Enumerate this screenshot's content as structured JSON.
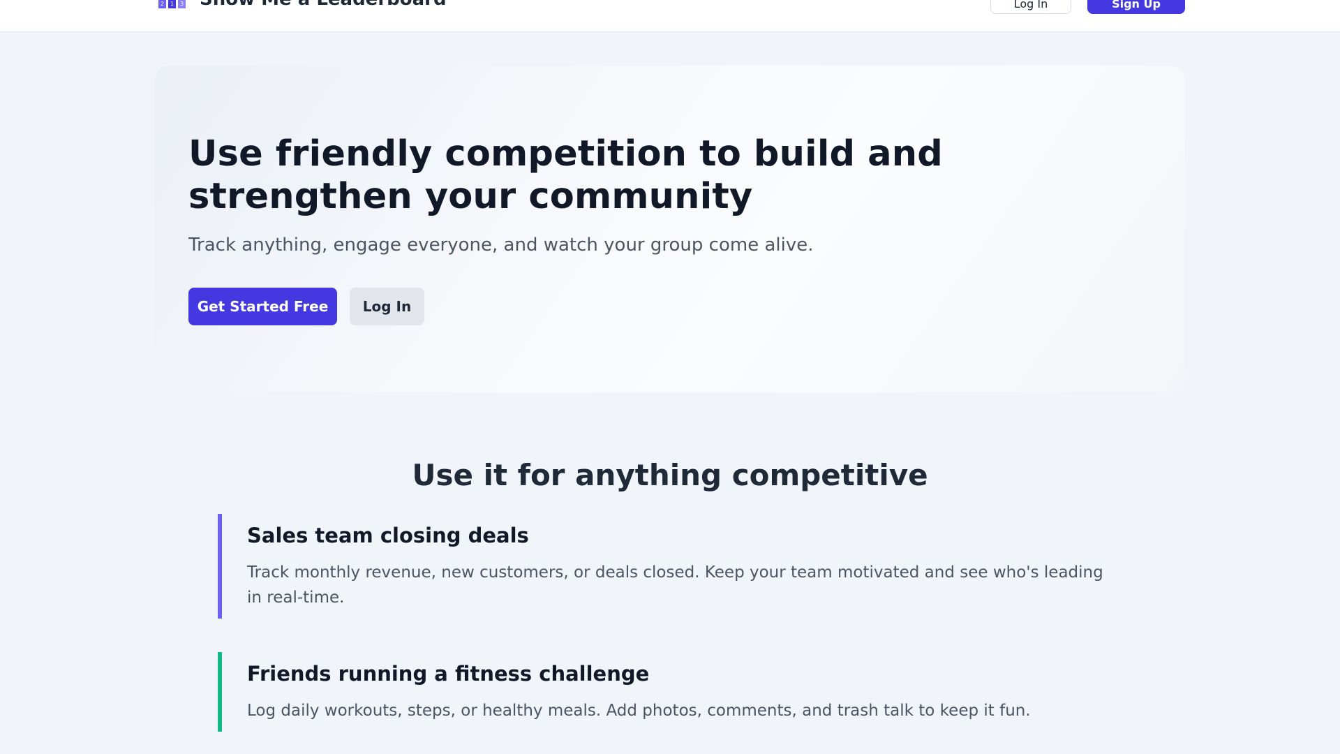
{
  "nav": {
    "brand_name": "Show Me a Leaderboard",
    "login_label": "Log In",
    "signup_label": "Sign Up"
  },
  "hero": {
    "title": "Use friendly competition to build and strengthen your community",
    "subtitle": "Track anything, engage everyone, and watch your group come alive.",
    "cta_primary": "Get Started Free",
    "cta_secondary": "Log In"
  },
  "use_cases": {
    "heading": "Use it for anything competitive",
    "items": [
      {
        "title": "Sales team closing deals",
        "description": "Track monthly revenue, new customers, or deals closed. Keep your team motivated and see who's leading in real-time.",
        "accent": "#6d5ff0"
      },
      {
        "title": "Friends running a fitness challenge",
        "description": "Log daily workouts, steps, or healthy meals. Add photos, comments, and trash talk to keep it fun.",
        "accent": "#10b981"
      }
    ]
  },
  "colors": {
    "brand": "#4438e0",
    "background": "#f1f4f8"
  },
  "icons": {
    "brand": "podium-icon"
  }
}
